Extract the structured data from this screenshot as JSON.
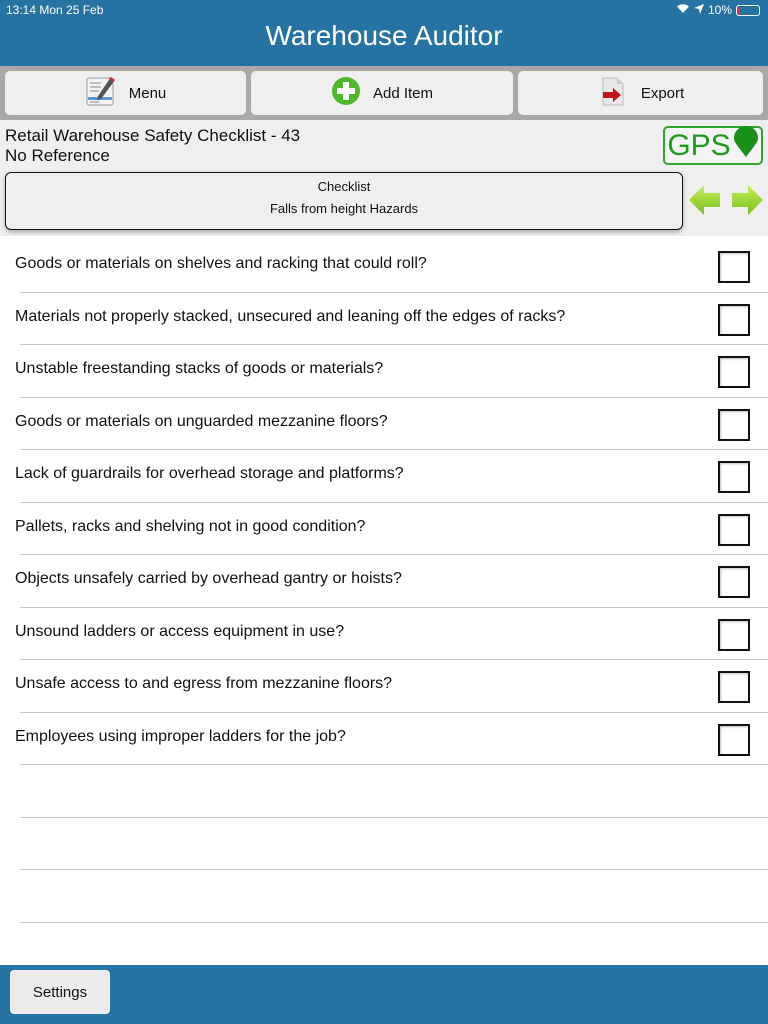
{
  "status_bar": {
    "time_date": "13:14  Mon 25 Feb",
    "battery": "10%",
    "battery_level_percent": 10
  },
  "header": {
    "title": "Warehouse Auditor"
  },
  "toolbar": {
    "menu_label": "Menu",
    "add_item_label": "Add Item",
    "export_label": "Export"
  },
  "info": {
    "checklist_title": "Retail Warehouse Safety Checklist - 43",
    "reference": "No Reference",
    "gps_label": "GPS",
    "gps_color": "#1f9a1f"
  },
  "section": {
    "heading": "Checklist",
    "name": "Falls from height Hazards"
  },
  "accent_color": "#2672a3",
  "questions": [
    {
      "text": "Goods or materials on shelves and racking that could roll?",
      "checked": false
    },
    {
      "text": "Materials not properly stacked, unsecured and leaning off the edges of racks?",
      "checked": false
    },
    {
      "text": "Unstable freestanding stacks of goods or materials?",
      "checked": false
    },
    {
      "text": "Goods or materials on unguarded mezzanine floors?",
      "checked": false
    },
    {
      "text": "Lack of guardrails for overhead storage and platforms?",
      "checked": false
    },
    {
      "text": "Pallets, racks and shelving not in good condition?",
      "checked": false
    },
    {
      "text": "Objects unsafely carried by overhead gantry or hoists?",
      "checked": false
    },
    {
      "text": "Unsound ladders or access equipment in use?",
      "checked": false
    },
    {
      "text": "Unsafe access to and egress from mezzanine floors?",
      "checked": false
    },
    {
      "text": "Employees using improper ladders for the job?",
      "checked": false
    }
  ],
  "footer": {
    "settings_label": "Settings"
  }
}
